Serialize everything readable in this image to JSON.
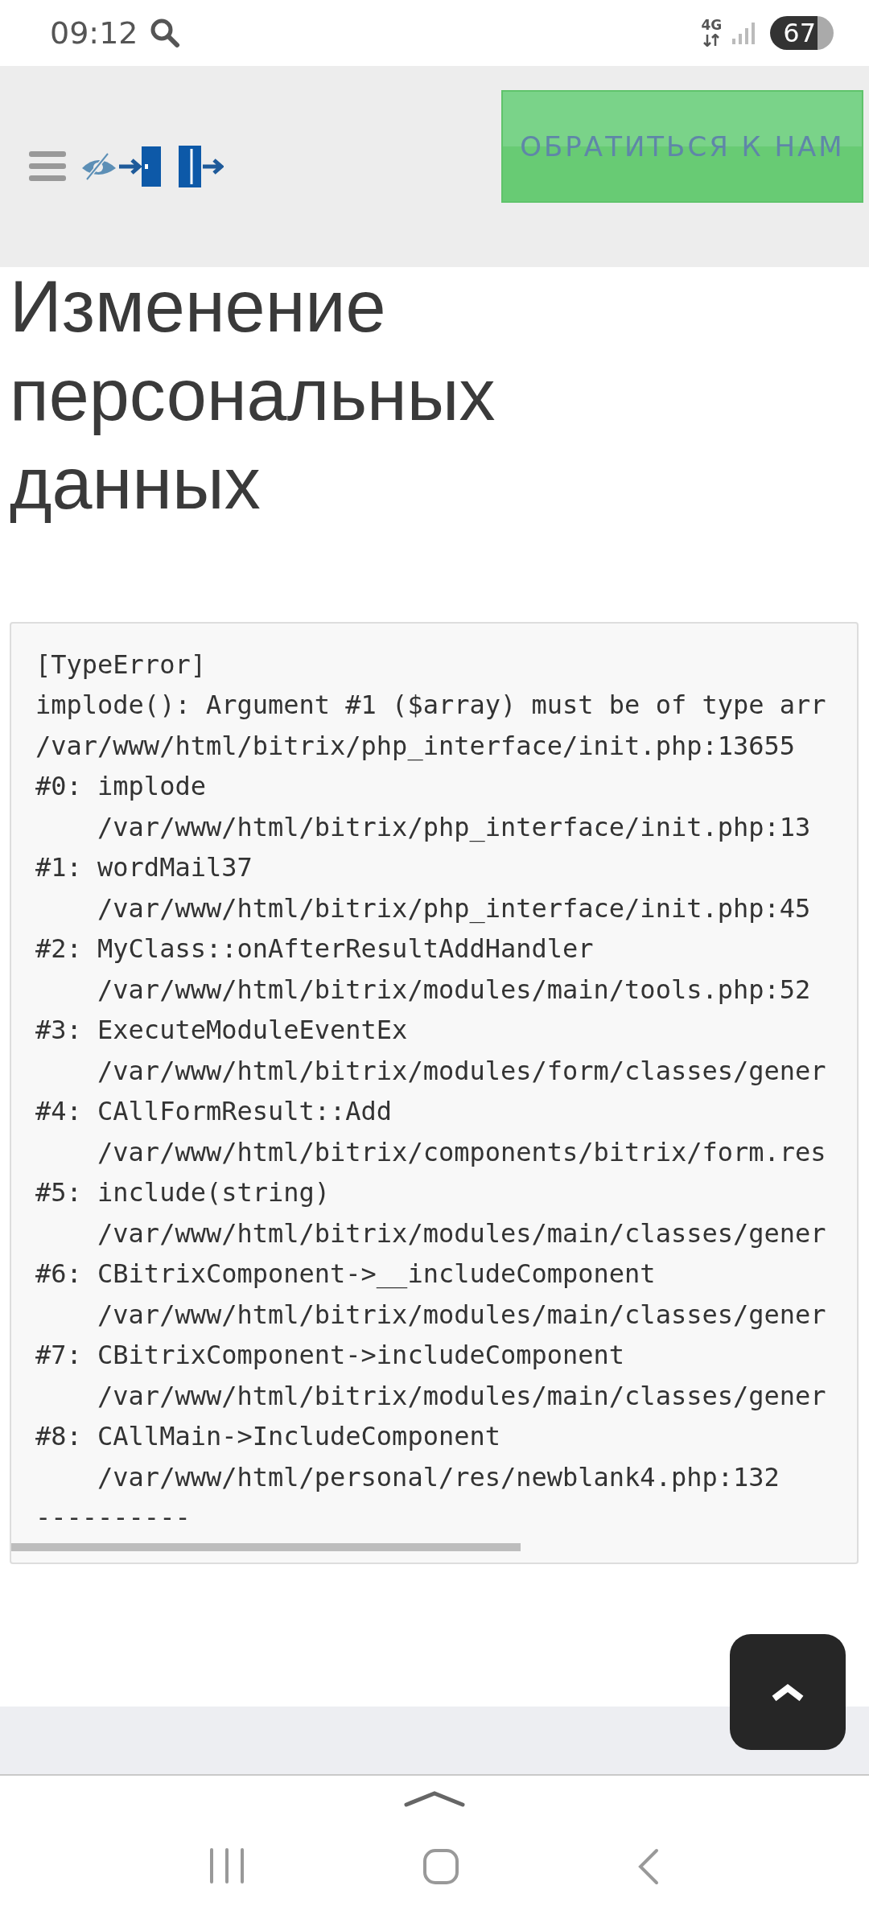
{
  "status_bar": {
    "time": "09:12",
    "network": "4G",
    "battery": "67"
  },
  "header": {
    "contact_button": "ОБРАТИТЬСЯ К НАМ"
  },
  "title": "Изменение персональных данных",
  "error_log": {
    "lines": [
      {
        "kind": "plain",
        "text": "[TypeError]"
      },
      {
        "kind": "plain",
        "text": "implode(): Argument #1 ($array) must be of type arr"
      },
      {
        "kind": "plain",
        "text": "/var/www/html/bitrix/php_interface/init.php:13655"
      },
      {
        "kind": "plain",
        "text": "#0: implode"
      },
      {
        "kind": "indent",
        "text": "/var/www/html/bitrix/php_interface/init.php:13"
      },
      {
        "kind": "plain",
        "text": "#1: wordMail37"
      },
      {
        "kind": "indent",
        "text": "/var/www/html/bitrix/php_interface/init.php:45"
      },
      {
        "kind": "plain",
        "text": "#2: MyClass::onAfterResultAddHandler"
      },
      {
        "kind": "indent",
        "text": "/var/www/html/bitrix/modules/main/tools.php:52"
      },
      {
        "kind": "plain",
        "text": "#3: ExecuteModuleEventEx"
      },
      {
        "kind": "indent",
        "text": "/var/www/html/bitrix/modules/form/classes/gener"
      },
      {
        "kind": "plain",
        "text": "#4: CAllFormResult::Add"
      },
      {
        "kind": "indent",
        "text": "/var/www/html/bitrix/components/bitrix/form.res"
      },
      {
        "kind": "plain",
        "text": "#5: include(string)"
      },
      {
        "kind": "indent",
        "text": "/var/www/html/bitrix/modules/main/classes/gener"
      },
      {
        "kind": "plain",
        "text": "#6: CBitrixComponent->__includeComponent"
      },
      {
        "kind": "indent",
        "text": "/var/www/html/bitrix/modules/main/classes/gener"
      },
      {
        "kind": "plain",
        "text": "#7: CBitrixComponent->includeComponent"
      },
      {
        "kind": "indent",
        "text": "/var/www/html/bitrix/modules/main/classes/gener"
      },
      {
        "kind": "plain",
        "text": "#8: CAllMain->IncludeComponent"
      },
      {
        "kind": "indent",
        "text": "/var/www/html/personal/res/newblank4.php:132"
      },
      {
        "kind": "plain",
        "text": "----------"
      }
    ]
  }
}
